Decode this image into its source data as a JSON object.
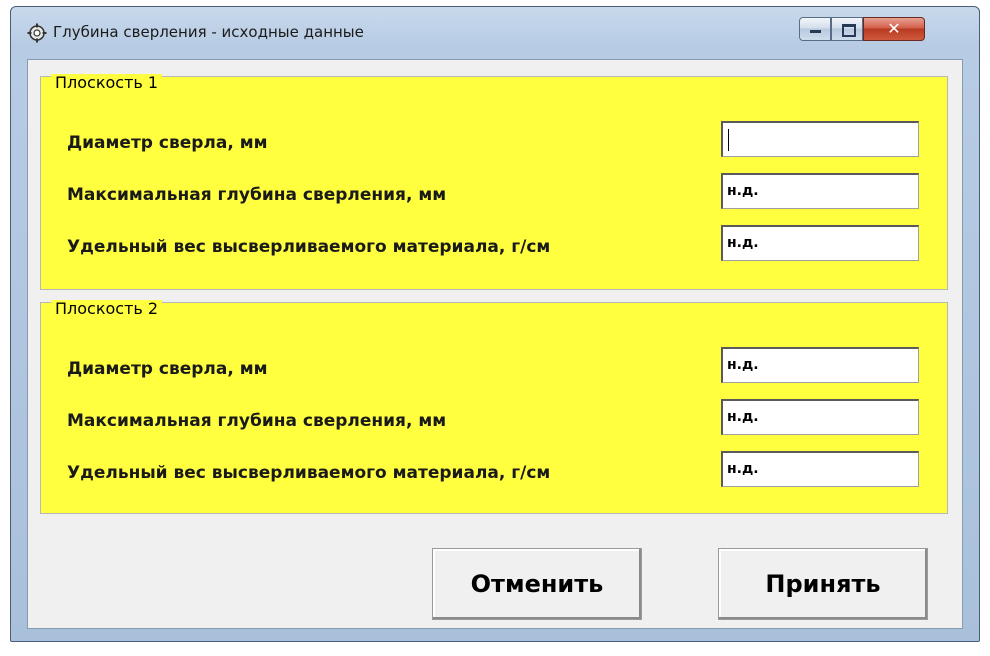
{
  "window": {
    "title": "Глубина сверления - исходные данные",
    "minimize_icon": "minimize-icon",
    "maximize_icon": "maximize-icon",
    "close_icon": "close-icon",
    "app_icon": "gear-icon"
  },
  "plane1": {
    "title": "Плоскость 1",
    "fields": [
      {
        "label": "Диаметр сверла, мм",
        "value": ""
      },
      {
        "label": "Максимальная глубина сверления, мм",
        "value": "н.д."
      },
      {
        "label": "Удельный вес высверливаемого материала, г/см",
        "value": "н.д."
      }
    ]
  },
  "plane2": {
    "title": "Плоскость 2",
    "fields": [
      {
        "label": "Диаметр сверла, мм",
        "value": "н.д."
      },
      {
        "label": "Максимальная глубина сверления, мм",
        "value": "н.д."
      },
      {
        "label": "Удельный вес высверливаемого материала, г/см",
        "value": "н.д."
      }
    ]
  },
  "buttons": {
    "cancel": "Отменить",
    "accept": "Принять"
  },
  "colors": {
    "group_background": "#ffff40",
    "client_background": "#f0f0f0",
    "close_button": "#c8452c"
  }
}
